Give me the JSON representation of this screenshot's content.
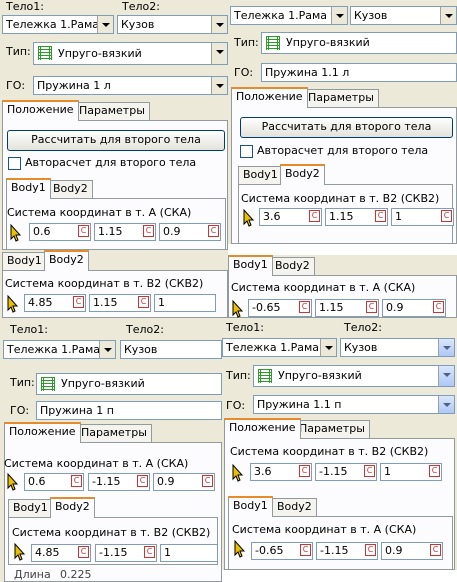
{
  "panel_a": {
    "body1_label": "Тело1:",
    "body2_label": "Тело2:",
    "body1_value": "Тележка 1.Рама те",
    "body2_value": "Кузов",
    "type_label": "Тип:",
    "type_value": "Упруго-вязкий",
    "go_label": "ГО:",
    "go_value": "Пружина 1 л",
    "tabs": [
      "Положение",
      "Параметры"
    ],
    "calc_button": "Рассчитать для второго тела",
    "auto_calc": "Авторасчет для второго тела",
    "inner_tabs": [
      "Body1",
      "Body2"
    ],
    "coord_label": "Система координат в т. А (СКА)",
    "coords": [
      "0.6",
      "1.15",
      "0.9"
    ]
  },
  "panel_b": {
    "body1_value": "Тележка 1.Рама те",
    "body2_value": "Кузов",
    "type_label": "Тип:",
    "type_value": "Упруго-вязкий",
    "go_label": "ГО:",
    "go_value": "Пружина 1.1 л",
    "tabs": [
      "Положение",
      "Параметры"
    ],
    "calc_button": "Рассчитать для второго тела",
    "auto_calc": "Авторасчет для второго тела",
    "inner_tabs": [
      "Body1",
      "Body2"
    ],
    "coord_label": "Система координат в т. B2 (СКВ2)",
    "coords": [
      "3.6",
      "1.15",
      "1"
    ]
  },
  "panel_c": {
    "inner_tabs": [
      "Body1",
      "Body2"
    ],
    "coord_label": "Система координат в т. B2 (СКВ2)",
    "coords": [
      "4.85",
      "1.15",
      "1"
    ]
  },
  "panel_d": {
    "inner_tabs": [
      "Body1",
      "Body2"
    ],
    "coord_label": "Система координат в т. А (СКА)",
    "coords": [
      "-0.65",
      "1.15",
      "0.9"
    ]
  },
  "panel_e": {
    "body1_label": "Тело1:",
    "body2_label": "Тело2:",
    "body1_value": "Тележка 1.Рама те",
    "body2_value": "Кузов",
    "type_label": "Тип:",
    "type_value": "Упруго-вязкий",
    "go_label": "ГО:",
    "go_value": "Пружина 1 п",
    "tabs": [
      "Положение",
      "Параметры"
    ],
    "coord_label_a": "Система координат в т. А (СКА)",
    "coords_a": [
      "0.6",
      "-1.15",
      "0.9"
    ],
    "inner_tabs": [
      "Body1",
      "Body2"
    ],
    "coord_label_b": "Система координат в т. B2 (СКВ2)",
    "coords_b": [
      "4.85",
      "-1.15",
      "1"
    ],
    "footer_label": "Длина",
    "footer_value": "0.225"
  },
  "panel_f": {
    "body1_label": "Тело1:",
    "body2_label": "Тело2:",
    "body1_value": "Тележка 1.Рама те",
    "body2_value": "Кузов",
    "type_label": "Тип:",
    "type_value": "Упруго-вязкий",
    "go_label": "ГО:",
    "go_value": "Пружина 1.1 п",
    "tabs": [
      "Положение",
      "Параметры"
    ],
    "coord_label_b": "Система координат в т. B2 (СКВ2)",
    "coords_b": [
      "3.6",
      "-1.15",
      "1"
    ],
    "inner_tabs": [
      "Body1",
      "Body2"
    ],
    "coord_label_a": "Система координат в т. А (СКА)",
    "coords_a": [
      "-0.65",
      "-1.15",
      "0.9"
    ]
  },
  "c_badge": "C",
  "colors": {
    "panel": "#ece9d8",
    "field_border": "#7f9db9",
    "tab_accent": "#e68b2c",
    "c_badge": "#cc3333"
  }
}
